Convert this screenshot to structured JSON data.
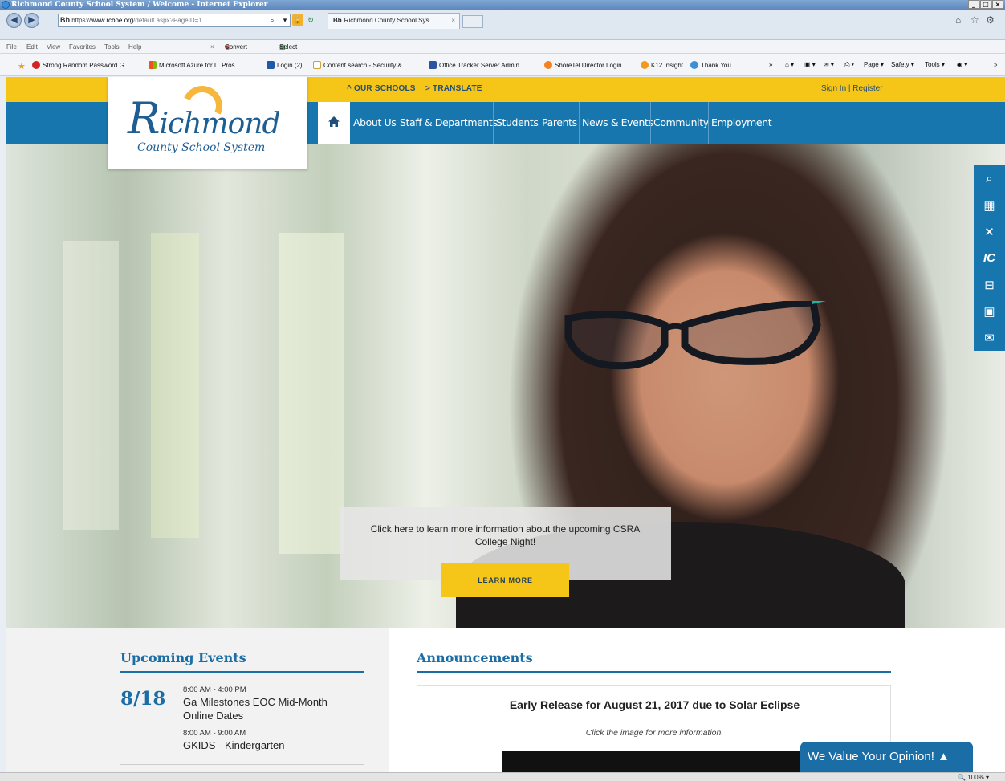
{
  "browser": {
    "window_title": "Richmond County School System / Welcome - Internet Explorer",
    "address_bold": "Bb",
    "address_scheme": " https://",
    "address_domain": "www.rcboe.org",
    "address_path": "/default.aspx?PageID=1",
    "tab_prefix": "Bb",
    "tab_title": "Richmond County School Sys...",
    "menu": [
      "File",
      "Edit",
      "View",
      "Favorites",
      "Tools",
      "Help"
    ],
    "commands": [
      "Convert",
      "Select"
    ],
    "favorites": [
      {
        "label": "Strong Random Password G...",
        "icon": "pinterest-icon",
        "color": "#d42323"
      },
      {
        "label": "Microsoft Azure for IT Pros ...",
        "icon": "windows-icon",
        "color": "#f25022"
      },
      {
        "label": "Login (2)",
        "icon": "bookmark-icon",
        "color": "#1e5aa8"
      },
      {
        "label": "Content search - Security &...",
        "icon": "page-icon",
        "color": "#cfa237"
      },
      {
        "label": "Office Tracker Server Admin...",
        "icon": "tracker-icon",
        "color": "#2b55a0"
      },
      {
        "label": "ShoreTel Director Login",
        "icon": "shoretel-icon",
        "color": "#f5821f"
      },
      {
        "label": "K12 Insight",
        "icon": "k12-icon",
        "color": "#f29a1f"
      },
      {
        "label": "Thank You",
        "icon": "ie-icon",
        "color": "#3b8fd8"
      }
    ],
    "tools": [
      "Page ▾",
      "Safety ▾",
      "Tools ▾"
    ],
    "zoom": "100%"
  },
  "site": {
    "top_links": [
      "^ OUR SCHOOLS",
      "> TRANSLATE"
    ],
    "sign_in": "Sign In",
    "register": "Register",
    "logo_r": "R",
    "logo_rest": "ichmond",
    "logo_sub": "County School System",
    "nav": [
      "About Us",
      "Staff & Departments",
      "Students",
      "Parents",
      "News & Events",
      "Community",
      "Employment"
    ],
    "hero_text": "Click here to learn more information about the upcoming CSRA College Night!",
    "hero_button": "LEARN MORE",
    "side_tool_ic": "IC",
    "events_title": "Upcoming Events",
    "event_date": "8/18",
    "events": [
      {
        "time": "8:00 AM - 4:00 PM",
        "name": "Ga Milestones EOC Mid-Month Online Dates"
      },
      {
        "time": "8:00 AM - 9:00 AM",
        "name": "GKIDS - Kindergarten"
      }
    ],
    "announcements_title": "Announcements",
    "announcement_headline": "Early Release for August 21, 2017 due to Solar Eclipse",
    "announcement_sub": "Click the image for more information.",
    "feedback_tab": "We Value Your Opinion! ▲"
  },
  "colors": {
    "brand_blue": "#1876ae",
    "brand_yellow": "#f5c518",
    "heading_blue": "#1b6da6"
  }
}
